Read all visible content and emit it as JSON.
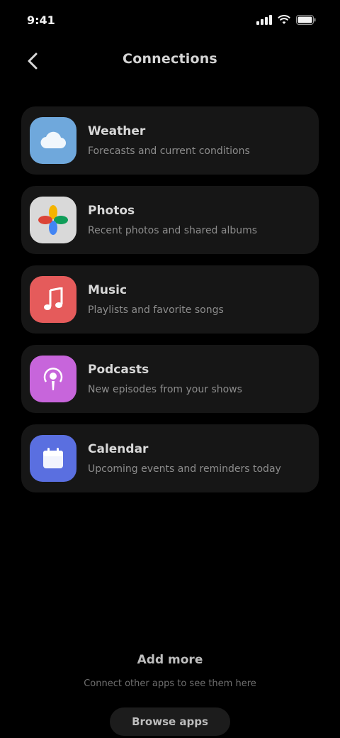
{
  "status_bar": {
    "time": "9:41"
  },
  "header": {
    "title": "Connections"
  },
  "apps": [
    {
      "name": "Weather",
      "description": "Forecasts and current conditions",
      "icon": "cloud-icon",
      "color": "#6FA8DC"
    },
    {
      "name": "Photos",
      "description": "Recent photos and shared albums",
      "icon": "photos-icon",
      "color": "#D9D9D9"
    },
    {
      "name": "Music",
      "description": "Playlists and favorite songs",
      "icon": "music-icon",
      "color": "#E55B5B"
    },
    {
      "name": "Podcasts",
      "description": "New episodes from your shows",
      "icon": "podcast-icon",
      "color": "#C765DB"
    },
    {
      "name": "Calendar",
      "description": "Upcoming events and reminders today",
      "icon": "calendar-icon",
      "color": "#5A6FE0"
    }
  ],
  "footer": {
    "title": "Add more",
    "text": "Connect other apps to see them here",
    "button_label": "Browse apps"
  }
}
